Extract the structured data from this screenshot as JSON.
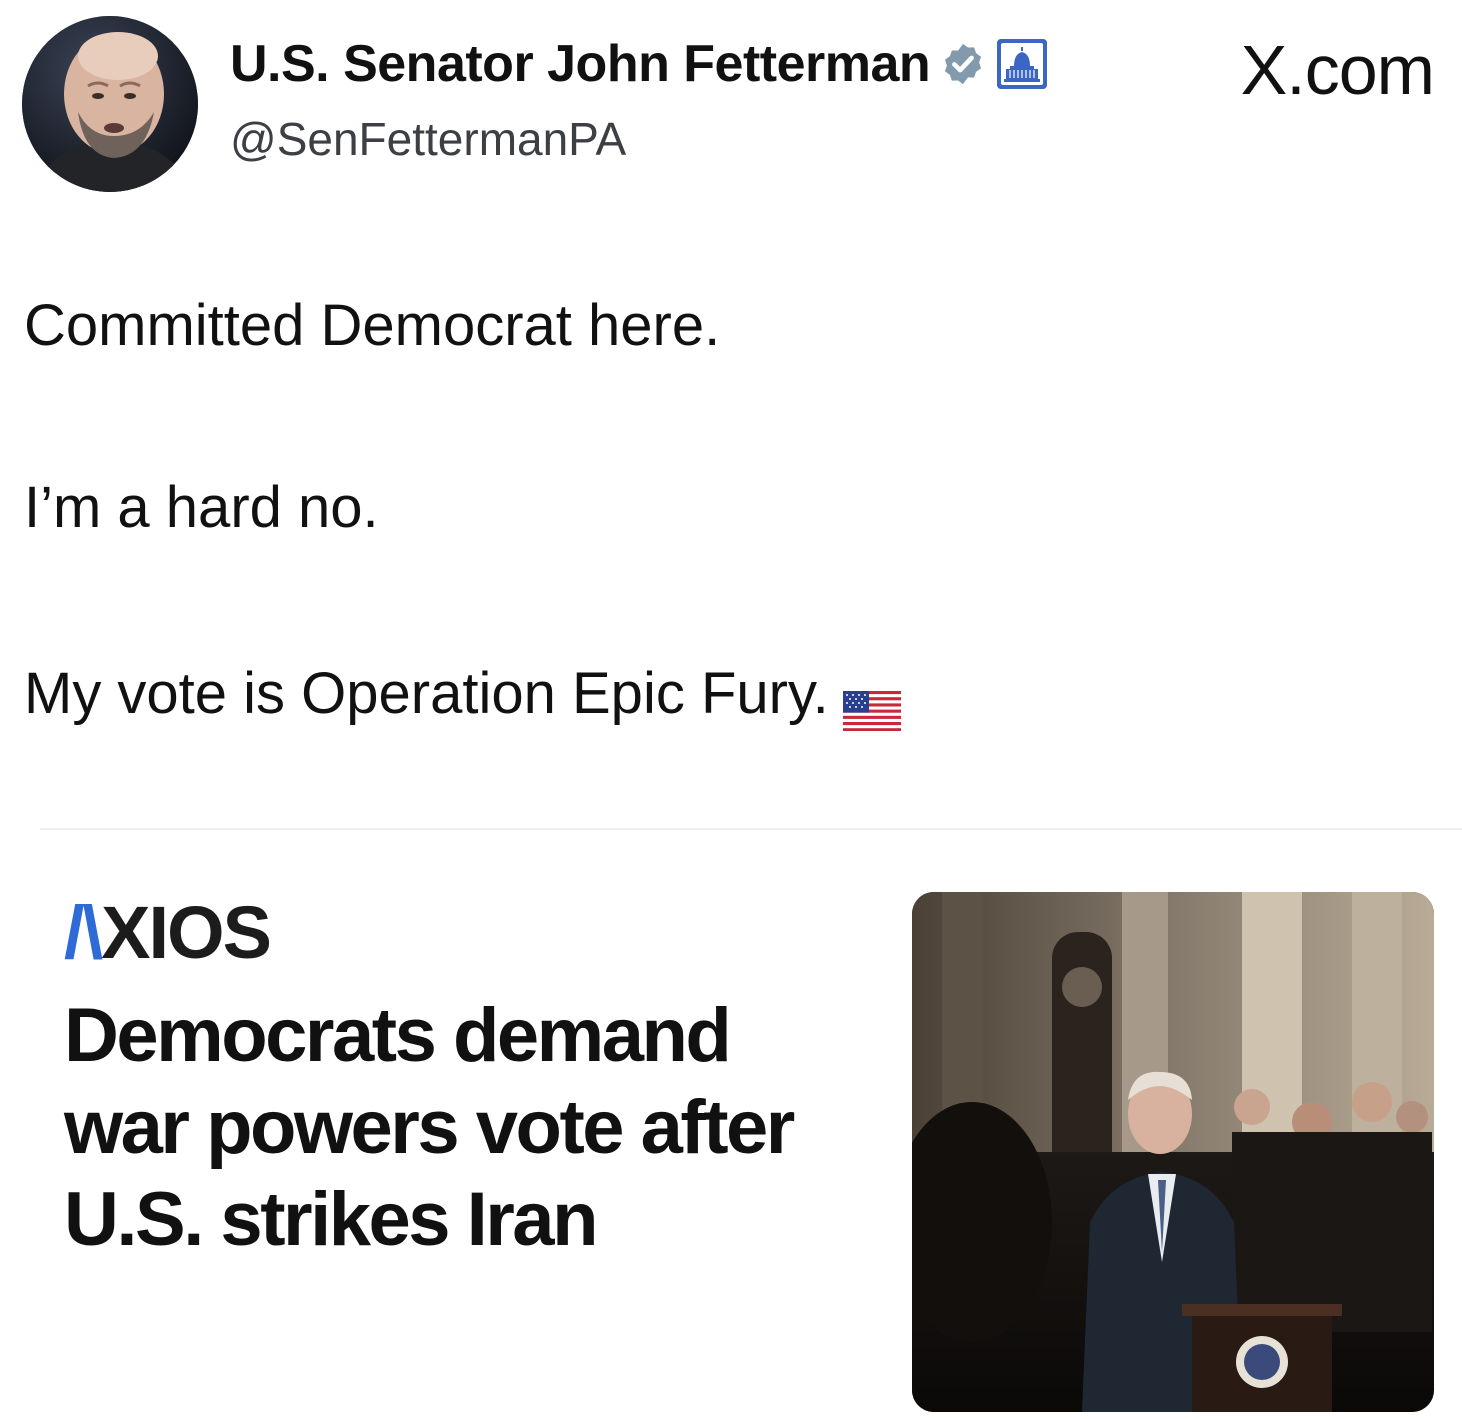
{
  "header": {
    "display_name": "U.S. Senator John Fetterman",
    "handle": "@SenFettermanPA",
    "site_label": "X.com",
    "verified_badge_color": "#829aab",
    "gov_icon": "capitol-icon"
  },
  "tweet": {
    "lines": [
      "Committed Democrat here.",
      "I’m a hard no.",
      "My vote is Operation Epic Fury."
    ],
    "trailing_emoji": "us-flag-icon"
  },
  "card": {
    "publisher": "XIOS",
    "publisher_slash": "/\\",
    "headline": "Democrats demand war powers vote after U.S. strikes Iran",
    "accent_color": "#2f6bd6"
  }
}
